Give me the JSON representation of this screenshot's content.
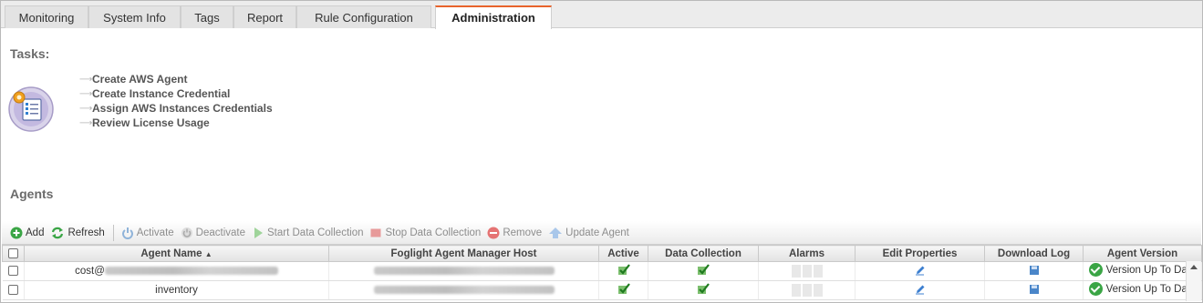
{
  "tabs": [
    {
      "label": "Monitoring",
      "active": false
    },
    {
      "label": "System Info",
      "active": false
    },
    {
      "label": "Tags",
      "active": false
    },
    {
      "label": "Report",
      "active": false
    },
    {
      "label": "Rule Configuration",
      "active": false
    },
    {
      "label": "Administration",
      "active": true
    }
  ],
  "tasks": {
    "title": "Tasks:",
    "icon": "tasks-checklist-icon",
    "items": [
      "Create AWS Agent",
      "Create Instance Credential",
      "Assign AWS Instances Credentials",
      "Review License Usage"
    ]
  },
  "agents": {
    "title": "Agents",
    "toolbar": {
      "add": "Add",
      "refresh": "Refresh",
      "activate": "Activate",
      "deactivate": "Deactivate",
      "start": "Start Data Collection",
      "stop": "Stop Data Collection",
      "remove": "Remove",
      "update": "Update Agent"
    },
    "columns": {
      "name": "Agent Name",
      "sort_indicator": "▲",
      "host": "Foglight Agent Manager Host",
      "active": "Active",
      "collection": "Data Collection",
      "alarms": "Alarms",
      "edit": "Edit Properties",
      "log": "Download Log",
      "version": "Agent Version"
    },
    "rows": [
      {
        "name_prefix": "cost@",
        "name_redacted": true,
        "host_redacted": true,
        "active": true,
        "collection": true,
        "version": "Version Up To Date"
      },
      {
        "name_prefix": "inventory",
        "name_redacted": false,
        "host_redacted": true,
        "active": true,
        "collection": true,
        "version": "Version Up To Date"
      }
    ]
  },
  "colors": {
    "active_tab_accent": "#e8632b",
    "ok_green": "#3aa545",
    "check_green": "#2e8b2e"
  }
}
